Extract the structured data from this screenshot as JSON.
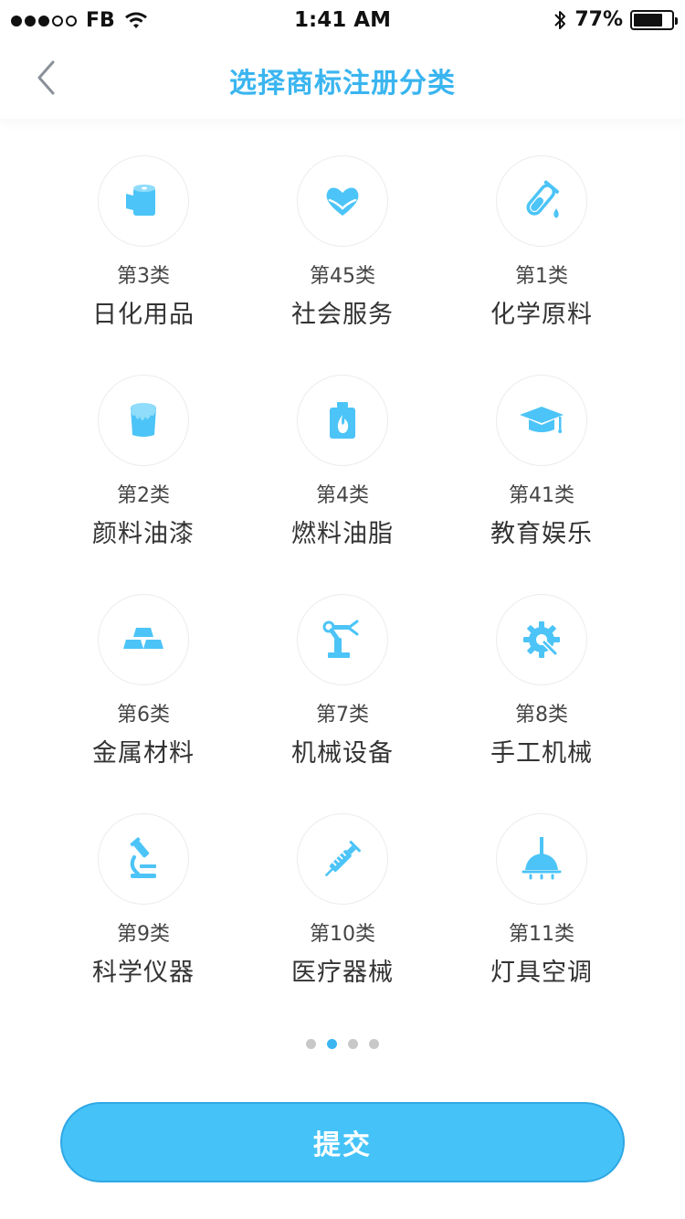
{
  "status_bar": {
    "carrier": "FB",
    "time": "1:41 AM",
    "battery_percent": "77%",
    "battery_level": 0.77
  },
  "nav": {
    "title": "选择商标注册分类",
    "back_icon": "chevron-left-icon"
  },
  "categories": [
    {
      "num": "第3类",
      "name": "日化用品",
      "icon": "tissue-roll-icon"
    },
    {
      "num": "第45类",
      "name": "社会服务",
      "icon": "heart-hands-icon"
    },
    {
      "num": "第1类",
      "name": "化学原料",
      "icon": "test-tube-icon"
    },
    {
      "num": "第2类",
      "name": "颜料油漆",
      "icon": "paint-bucket-icon"
    },
    {
      "num": "第4类",
      "name": "燃料油脂",
      "icon": "fuel-can-icon"
    },
    {
      "num": "第41类",
      "name": "教育娱乐",
      "icon": "graduation-cap-icon"
    },
    {
      "num": "第6类",
      "name": "金属材料",
      "icon": "gold-bars-icon"
    },
    {
      "num": "第7类",
      "name": "机械设备",
      "icon": "robot-arm-icon"
    },
    {
      "num": "第8类",
      "name": "手工机械",
      "icon": "gear-wrench-icon"
    },
    {
      "num": "第9类",
      "name": "科学仪器",
      "icon": "microscope-icon"
    },
    {
      "num": "第10类",
      "name": "医疗器械",
      "icon": "syringe-icon"
    },
    {
      "num": "第11类",
      "name": "灯具空调",
      "icon": "ceiling-lamp-icon"
    }
  ],
  "pager": {
    "pages": 4,
    "active_index": 1
  },
  "submit_label": "提交",
  "colors": {
    "accent": "#3ab5f0",
    "icon": "#4cc4f7",
    "button": "#45c3f8"
  }
}
